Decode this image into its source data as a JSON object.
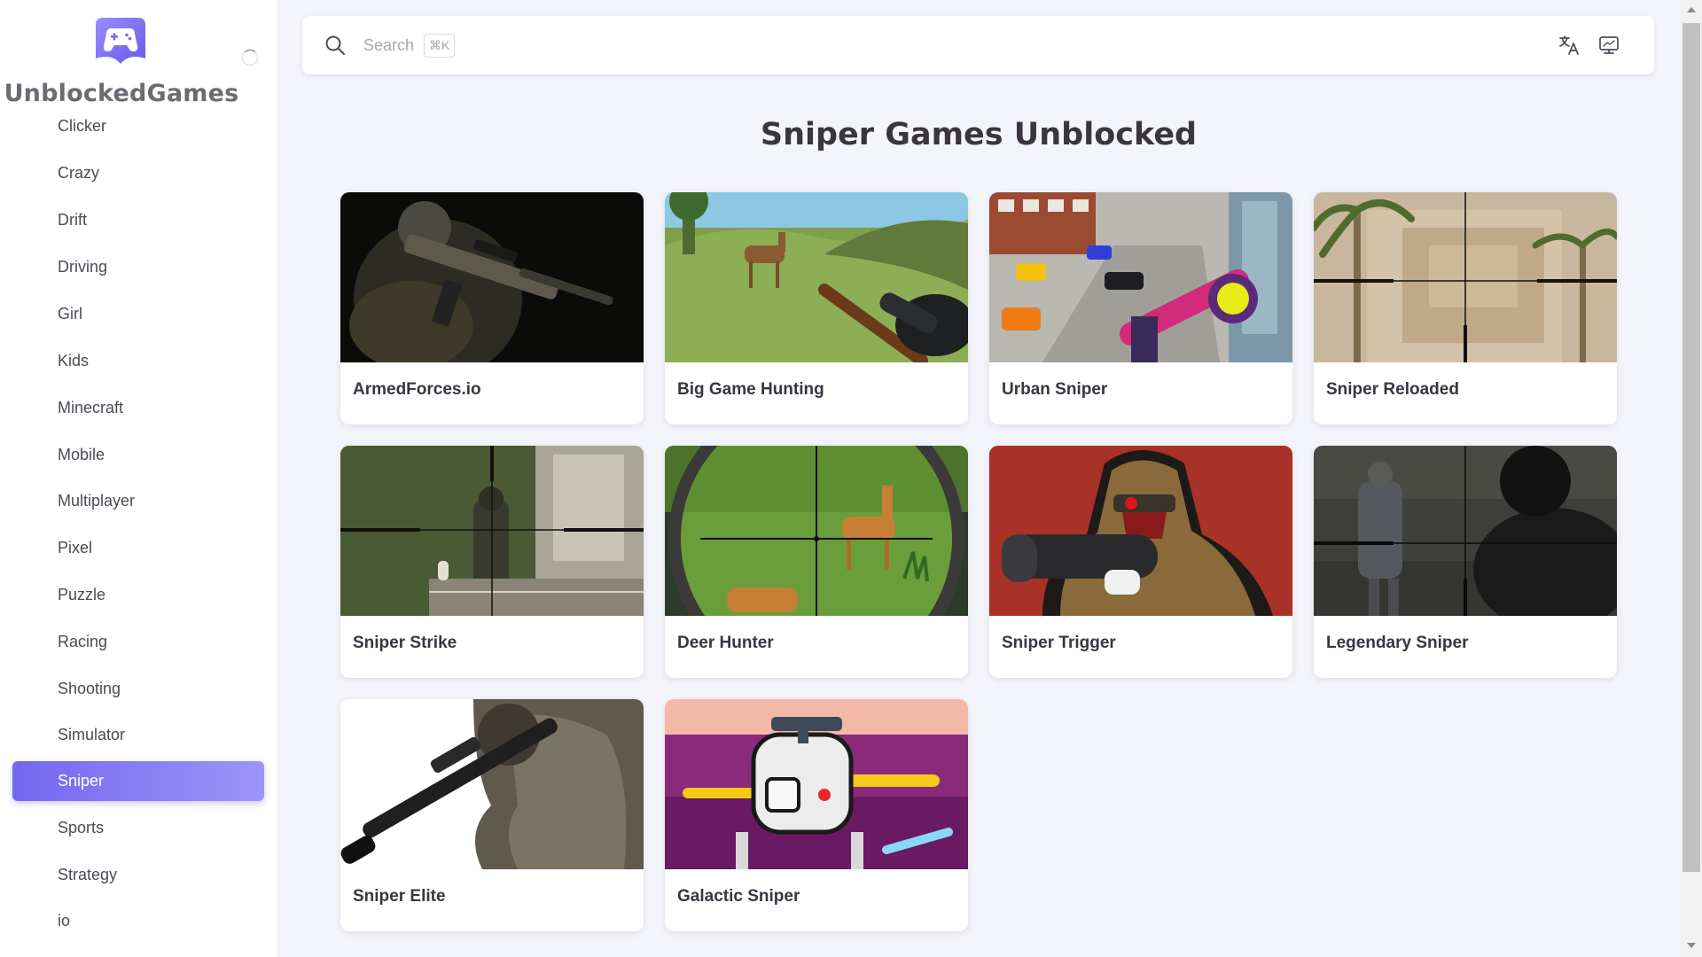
{
  "brand": {
    "title": "UnblockedGames",
    "logo_icon": "gamepad-icon",
    "accent": "#7367f0"
  },
  "sidebar": {
    "items": [
      {
        "label": "Clicker",
        "active": false
      },
      {
        "label": "Crazy",
        "active": false
      },
      {
        "label": "Drift",
        "active": false
      },
      {
        "label": "Driving",
        "active": false
      },
      {
        "label": "Girl",
        "active": false
      },
      {
        "label": "Kids",
        "active": false
      },
      {
        "label": "Minecraft",
        "active": false
      },
      {
        "label": "Mobile",
        "active": false
      },
      {
        "label": "Multiplayer",
        "active": false
      },
      {
        "label": "Pixel",
        "active": false
      },
      {
        "label": "Puzzle",
        "active": false
      },
      {
        "label": "Racing",
        "active": false
      },
      {
        "label": "Shooting",
        "active": false
      },
      {
        "label": "Simulator",
        "active": false
      },
      {
        "label": "Sniper",
        "active": true
      },
      {
        "label": "Sports",
        "active": false
      },
      {
        "label": "Strategy",
        "active": false
      },
      {
        "label": "io",
        "active": false
      }
    ]
  },
  "search": {
    "label": "Search",
    "shortcut": "⌘K",
    "icon": "search-icon"
  },
  "topbar": {
    "translate_icon": "translate-icon",
    "display_icon": "monitor-icon"
  },
  "main": {
    "title": "Sniper Games Unblocked",
    "games": [
      {
        "title": "ArmedForces.io"
      },
      {
        "title": "Big Game Hunting"
      },
      {
        "title": "Urban Sniper"
      },
      {
        "title": "Sniper Reloaded"
      },
      {
        "title": "Sniper Strike"
      },
      {
        "title": "Deer Hunter"
      },
      {
        "title": "Sniper Trigger"
      },
      {
        "title": "Legendary Sniper"
      },
      {
        "title": "Sniper Elite"
      },
      {
        "title": "Galactic Sniper"
      }
    ]
  }
}
